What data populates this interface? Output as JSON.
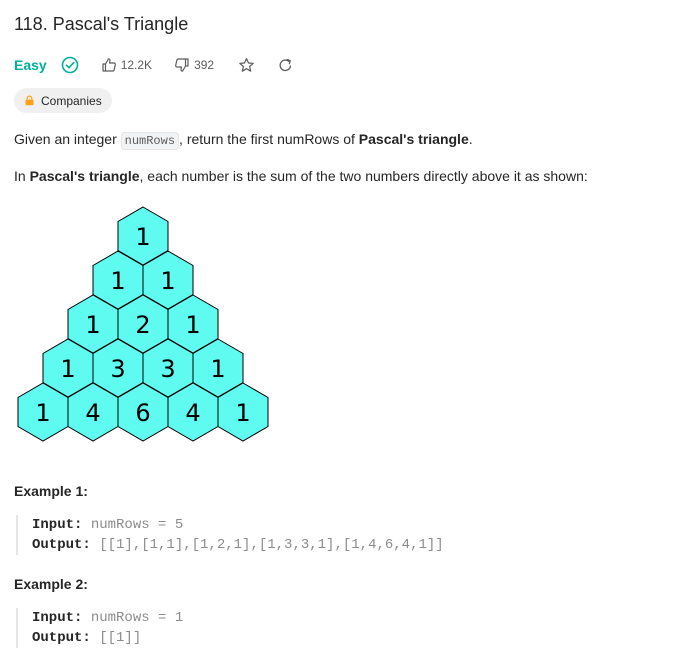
{
  "problem": {
    "title": "118. Pascal's Triangle",
    "difficulty": "Easy",
    "likes": "12.2K",
    "dislikes": "392",
    "companies_label": "Companies"
  },
  "description": {
    "p1_a": "Given an integer ",
    "p1_code": "numRows",
    "p1_b": ", return the first numRows of ",
    "p1_bold": "Pascal's triangle",
    "p1_c": ".",
    "p2_a": "In ",
    "p2_bold": "Pascal's triangle",
    "p2_b": ", each number is the sum of the two numbers directly above it as shown:"
  },
  "triangle": {
    "rows": [
      [
        1
      ],
      [
        1,
        1
      ],
      [
        1,
        2,
        1
      ],
      [
        1,
        3,
        3,
        1
      ],
      [
        1,
        4,
        6,
        4,
        1
      ]
    ],
    "fill": "#5ffbf1",
    "stroke": "#000000"
  },
  "examples": [
    {
      "title": "Example 1:",
      "input_label": "Input:",
      "input_value": "numRows = 5",
      "output_label": "Output:",
      "output_value": "[[1],[1,1],[1,2,1],[1,3,3,1],[1,4,6,4,1]]"
    },
    {
      "title": "Example 2:",
      "input_label": "Input:",
      "input_value": "numRows = 1",
      "output_label": "Output:",
      "output_value": "[[1]]"
    }
  ],
  "colors": {
    "easy": "#00af9b",
    "text": "#262626",
    "muted": "#8c8c8c"
  }
}
